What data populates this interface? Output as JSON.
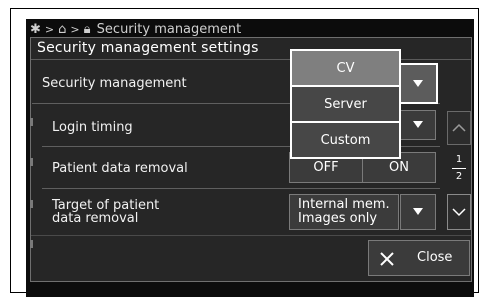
{
  "breadcrumb": {
    "items": [
      "Security management"
    ],
    "separator": ">"
  },
  "dialog": {
    "title": "Security management settings"
  },
  "rows": {
    "security_management": {
      "label": "Security management"
    },
    "login_timing": {
      "label": "Login timing"
    },
    "patient_data_removal": {
      "label": "Patient data removal",
      "off": "OFF",
      "on": "ON"
    },
    "target_removal": {
      "label_line1": "Target of patient",
      "label_line2": "data removal",
      "value_line1": "Internal mem.",
      "value_line2": "Images only"
    }
  },
  "dropdown_menu": {
    "options": [
      "CV",
      "Server",
      "Custom"
    ],
    "selected": "CV"
  },
  "pager": {
    "current": "1",
    "total": "2"
  },
  "footer": {
    "close_label": "Close"
  },
  "colors": {
    "background": "#262626",
    "selected_option": "#7f7f7f",
    "option": "#474747",
    "highlight": "#ffffff"
  },
  "icons": [
    "gear-icon",
    "lock-icon",
    "dropdown-arrow-icon",
    "scroll-up-icon",
    "scroll-down-icon",
    "close-icon"
  ]
}
